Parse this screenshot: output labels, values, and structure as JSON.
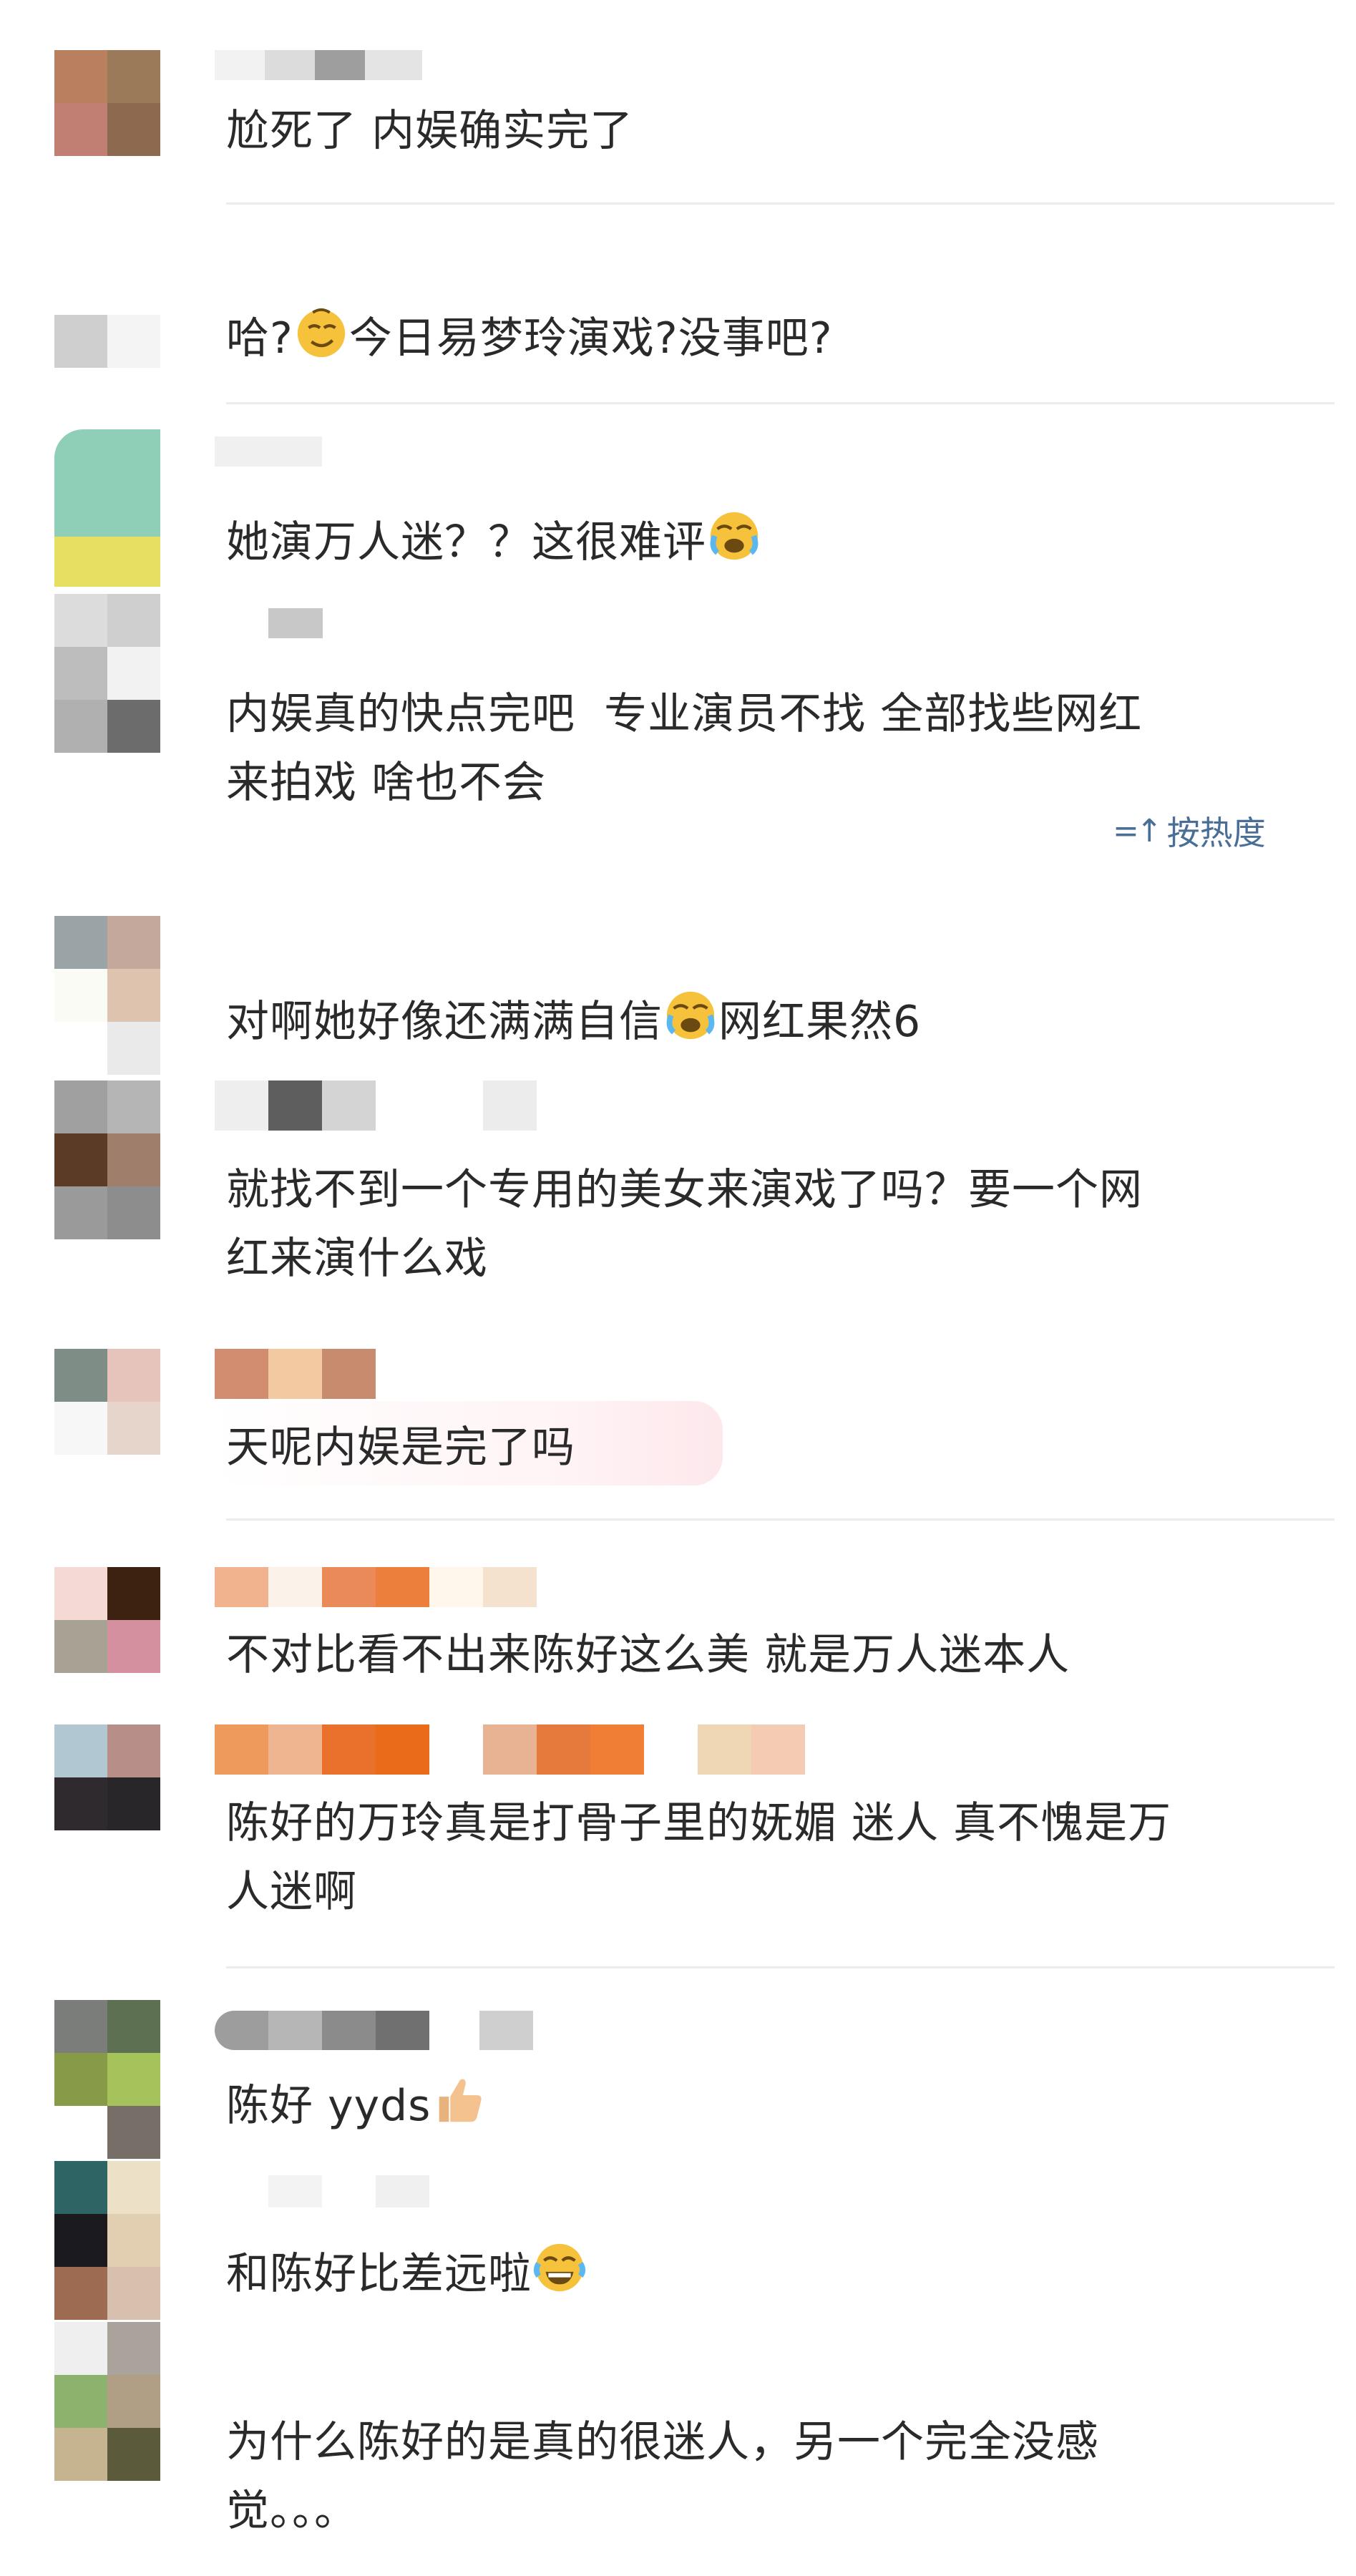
{
  "comments": [
    {
      "text": "尬死了 内娱确实完了"
    },
    {
      "text": "哈?",
      "text_after": "今日易梦玲演戏?没事吧?",
      "emoji": "smirking-face-icon"
    },
    {
      "text": "她演万人迷？？这很难评",
      "emoji": "crying-laughing-icon"
    },
    {
      "text": "内娱真的快点完吧  专业演员不找 全部找些网红\n来拍戏 啥也不会"
    },
    {
      "text": "对啊她好像还满满自信",
      "text_after": "网红果然6",
      "emoji": "crying-laughing-icon"
    },
    {
      "text": "就找不到一个专用的美女来演戏了吗？要一个网\n红来演什么戏"
    },
    {
      "text": "天呢内娱是完了吗"
    },
    {
      "text": "不对比看不出来陈好这么美 就是万人迷本人"
    },
    {
      "text": "陈好的万玲真是打骨子里的妩媚 迷人 真不愧是万\n人迷啊"
    },
    {
      "text": "陈好 yyds",
      "emoji": "thumbs-up-icon"
    },
    {
      "text": "和陈好比差远啦",
      "emoji": "tears-of-joy-icon"
    },
    {
      "text": "为什么陈好的是真的很迷人，另一个完全没感\n觉。。。"
    }
  ],
  "sort_toggle": {
    "label": "按热度",
    "icon": "sort-arrows-icon"
  },
  "colors": {
    "text": "#2a2a2a",
    "link": "#4a6f96",
    "divider": "#ececec"
  }
}
